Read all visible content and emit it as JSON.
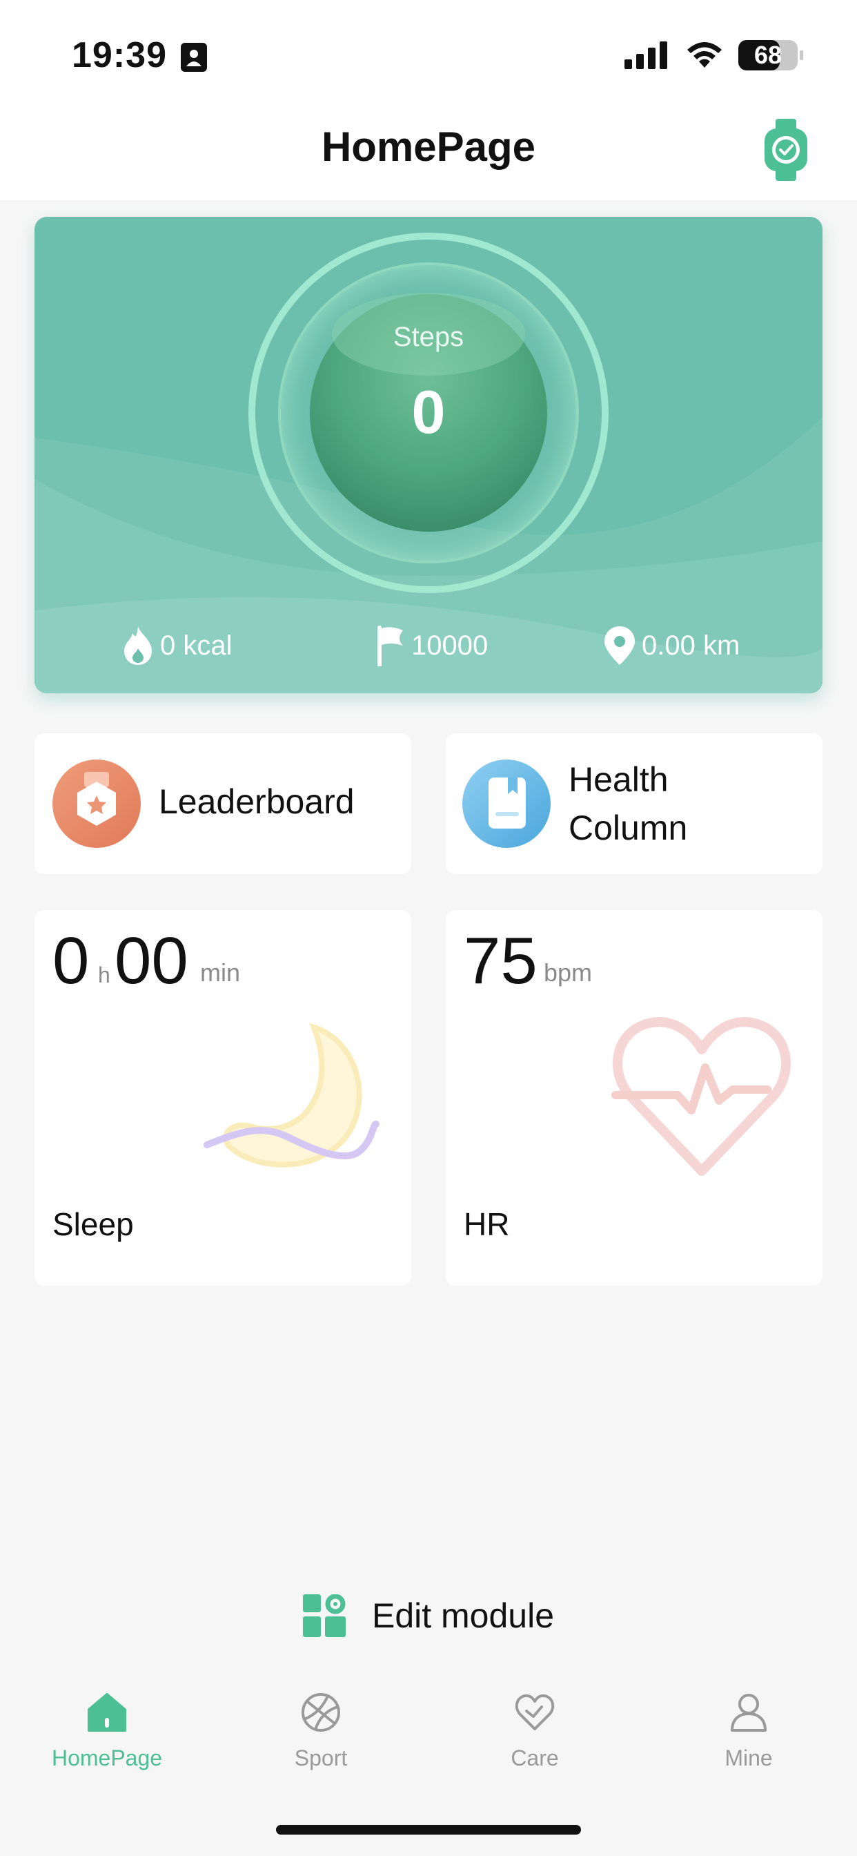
{
  "status_bar": {
    "time": "19:39",
    "battery": "68"
  },
  "header": {
    "title": "HomePage",
    "device_icon": "watch-connected-icon"
  },
  "steps_card": {
    "label": "Steps",
    "value": "0",
    "calories": "0 kcal",
    "goal": "10000",
    "distance": "0.00 km"
  },
  "features": {
    "leaderboard": "Leaderboard",
    "health_column_line1": "Health",
    "health_column_line2": "Column"
  },
  "sleep": {
    "hours": "0",
    "h_unit": "h",
    "minutes": "00",
    "min_unit": "min",
    "label": "Sleep"
  },
  "hr": {
    "value": "75",
    "unit": "bpm",
    "label": "HR"
  },
  "edit_module": {
    "label": "Edit module"
  },
  "tabs": [
    {
      "label": "HomePage",
      "icon": "home-icon",
      "active": true
    },
    {
      "label": "Sport",
      "icon": "ball-icon",
      "active": false
    },
    {
      "label": "Care",
      "icon": "heart-icon",
      "active": false
    },
    {
      "label": "Mine",
      "icon": "person-icon",
      "active": false
    }
  ],
  "colors": {
    "accent": "#4cbf95",
    "card_green": "#6cbfad",
    "leaderboard_orange": "#e98a68",
    "health_blue": "#6bbde8"
  }
}
